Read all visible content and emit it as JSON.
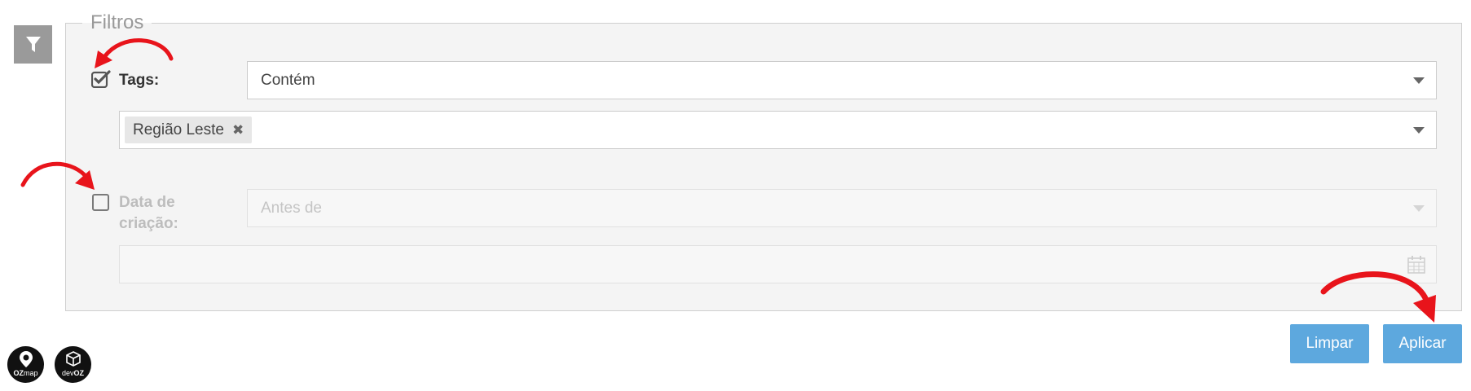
{
  "filters": {
    "legend": "Filtros",
    "tags": {
      "label": "Tags:",
      "checked": true,
      "operator": "Contém",
      "selected_tags": [
        "Região Leste"
      ]
    },
    "creation_date": {
      "label_line1": "Data de",
      "label_line2": "criação:",
      "checked": false,
      "operator": "Antes de",
      "date_value": ""
    }
  },
  "actions": {
    "clear_label": "Limpar",
    "apply_label": "Aplicar"
  },
  "logos": {
    "ozmap": {
      "text_light": "OZ",
      "text_dark": "map"
    },
    "devoz": {
      "text_light": "dev",
      "text_dark": "OZ"
    }
  },
  "colors": {
    "primary_button": "#5da8de",
    "annotation_arrow": "#e8141b",
    "panel_background": "#f4f4f4"
  }
}
